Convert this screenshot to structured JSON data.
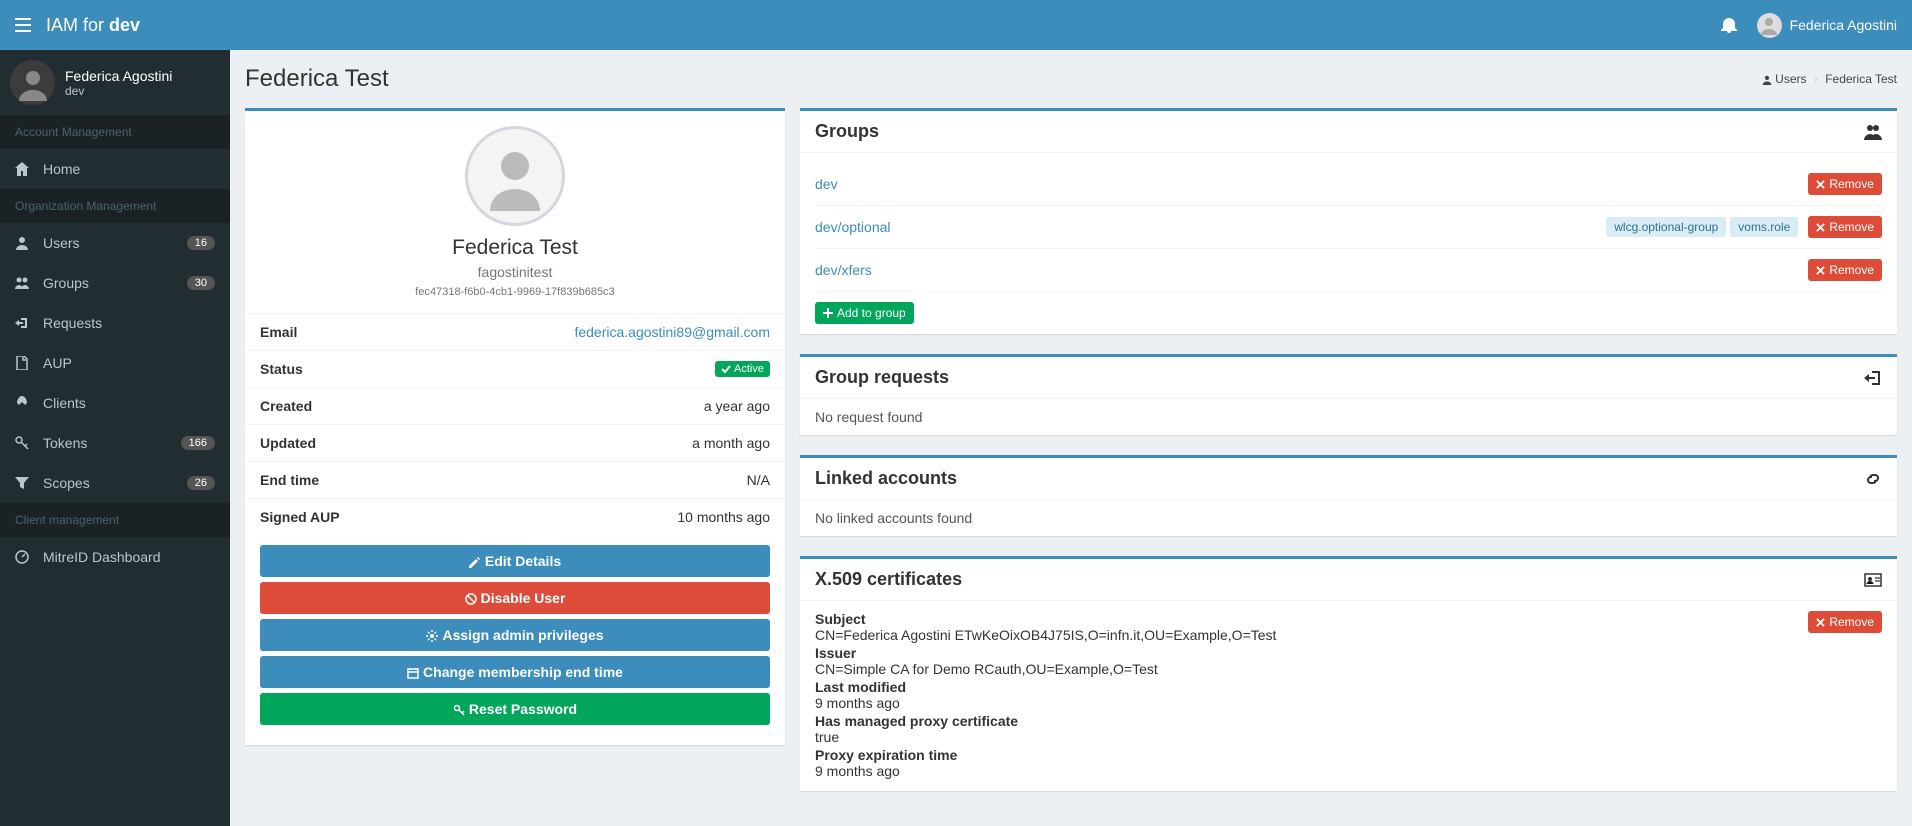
{
  "topbar": {
    "brand_prefix": "IAM for ",
    "brand_bold": "dev",
    "user_name": "Federica Agostini"
  },
  "sidebar": {
    "user_name": "Federica Agostini",
    "user_org": "dev",
    "section1": "Account Management",
    "home": "Home",
    "section2": "Organization Management",
    "users": "Users",
    "users_count": "16",
    "groups": "Groups",
    "groups_count": "30",
    "requests": "Requests",
    "aup": "AUP",
    "clients": "Clients",
    "tokens": "Tokens",
    "tokens_count": "166",
    "scopes": "Scopes",
    "scopes_count": "26",
    "section3": "Client management",
    "mitreid": "MitreID Dashboard"
  },
  "page": {
    "title": "Federica Test",
    "breadcrumb_users": "Users",
    "breadcrumb_current": "Federica Test"
  },
  "profile": {
    "name": "Federica Test",
    "username": "fagostinitest",
    "uuid": "fec47318-f6b0-4cb1-9969-17f839b685c3",
    "email_label": "Email",
    "email_value": "federica.agostini89@gmail.com",
    "status_label": "Status",
    "status_value": "Active",
    "created_label": "Created",
    "created_value": "a year ago",
    "updated_label": "Updated",
    "updated_value": "a month ago",
    "endtime_label": "End time",
    "endtime_value": "N/A",
    "aup_label": "Signed AUP",
    "aup_value": "10 months ago"
  },
  "buttons": {
    "edit": "Edit Details",
    "disable": "Disable User",
    "admin": "Assign admin privileges",
    "endtime": "Change membership end time",
    "reset": "Reset Password",
    "add_group": "Add to group",
    "remove": "Remove"
  },
  "groups_panel": {
    "title": "Groups",
    "items": [
      {
        "name": "dev",
        "labels": []
      },
      {
        "name": "dev/optional",
        "labels": [
          "wlcg.optional-group",
          "voms.role"
        ]
      },
      {
        "name": "dev/xfers",
        "labels": []
      }
    ]
  },
  "group_requests": {
    "title": "Group requests",
    "empty": "No request found"
  },
  "linked_accounts": {
    "title": "Linked accounts",
    "empty": "No linked accounts found"
  },
  "certs": {
    "title": "X.509 certificates",
    "subject_label": "Subject",
    "subject_value": "CN=Federica Agostini ETwKeOixOB4J75IS,O=infn.it,OU=Example,O=Test",
    "issuer_label": "Issuer",
    "issuer_value": "CN=Simple CA for Demo RCauth,OU=Example,O=Test",
    "modified_label": "Last modified",
    "modified_value": "9 months ago",
    "proxy_label": "Has managed proxy certificate",
    "proxy_value": "true",
    "proxy_exp_label": "Proxy expiration time",
    "proxy_exp_value": "9 months ago"
  }
}
